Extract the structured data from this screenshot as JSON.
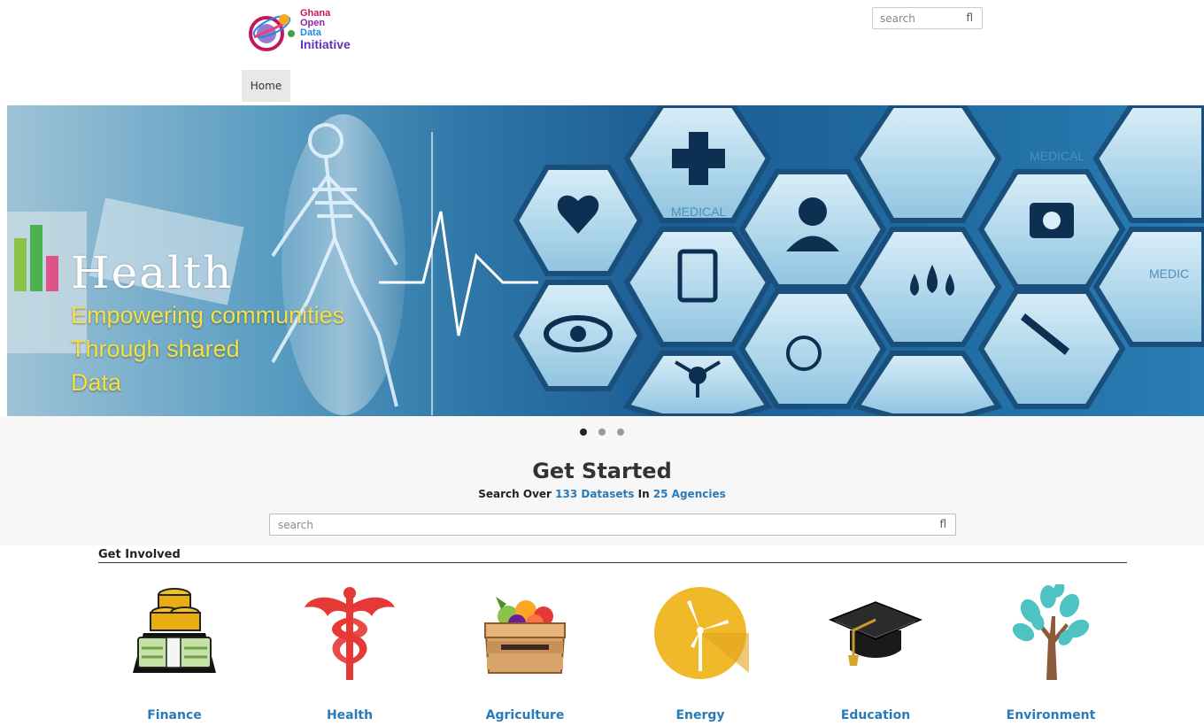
{
  "header": {
    "logo_lines": [
      "Ghana",
      "Open",
      "Data",
      "Initiative"
    ],
    "search_placeholder": "search",
    "search_icon_glyph": "fl"
  },
  "nav": {
    "items": [
      {
        "label": "Home"
      }
    ]
  },
  "banner": {
    "title": "Health",
    "lines": [
      "Empowering communities",
      "Through shared",
      "Data"
    ],
    "icon_labels": [
      "MEDICAL",
      "MEDICAL",
      "MEDIC"
    ],
    "slide_count": 3,
    "active_slide": 1
  },
  "get_started": {
    "title": "Get Started",
    "sub_prefix": "Search Over ",
    "datasets": "133 Datasets",
    "sub_mid": " In ",
    "agencies": "25 Agencies",
    "search_placeholder": "search",
    "search_icon_glyph": "fl"
  },
  "get_involved": {
    "title": "Get Involved",
    "categories": [
      {
        "label": "Finance",
        "icon": "money-stack-icon"
      },
      {
        "label": "Health",
        "icon": "caduceus-icon"
      },
      {
        "label": "Agriculture",
        "icon": "produce-crate-icon"
      },
      {
        "label": "Energy",
        "icon": "wind-turbine-icon"
      },
      {
        "label": "Education",
        "icon": "graduation-cap-icon"
      },
      {
        "label": "Environment",
        "icon": "tree-icon"
      }
    ]
  },
  "colors": {
    "link": "#2a7ab8",
    "banner_text": "#f5e142",
    "energy_circle": "#f0b92a",
    "health_red": "#e53935",
    "tree_teal": "#4fc3c3"
  }
}
